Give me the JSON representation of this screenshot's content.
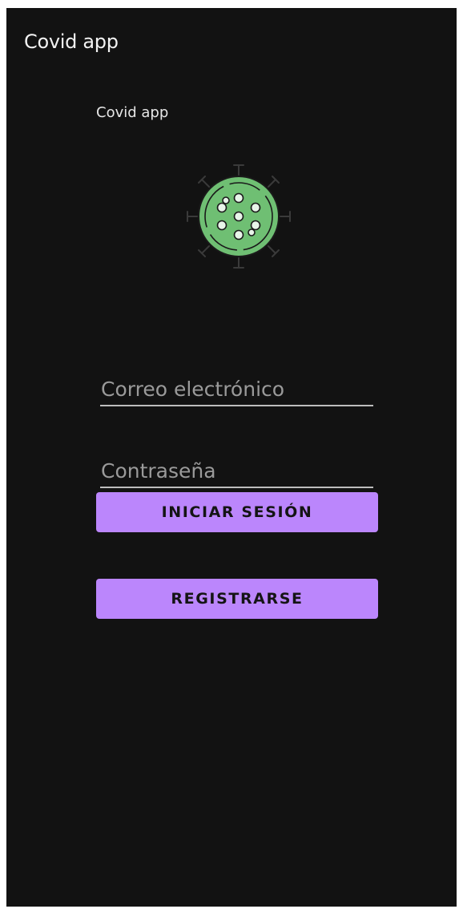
{
  "app_bar": {
    "title": "Covid app"
  },
  "content": {
    "label": "Covid app",
    "logo_icon": "virus-icon"
  },
  "form": {
    "email": {
      "value": "",
      "placeholder": "Correo electrónico"
    },
    "password": {
      "value": "",
      "placeholder": "Contraseña"
    }
  },
  "buttons": {
    "login_label": "INICIAR SESIÓN",
    "register_label": "REGISTRARSE"
  },
  "colors": {
    "background": "#121212",
    "accent": "#bb86fc",
    "virus_fill": "#6fbf73",
    "virus_outline": "#1a1a1a"
  }
}
